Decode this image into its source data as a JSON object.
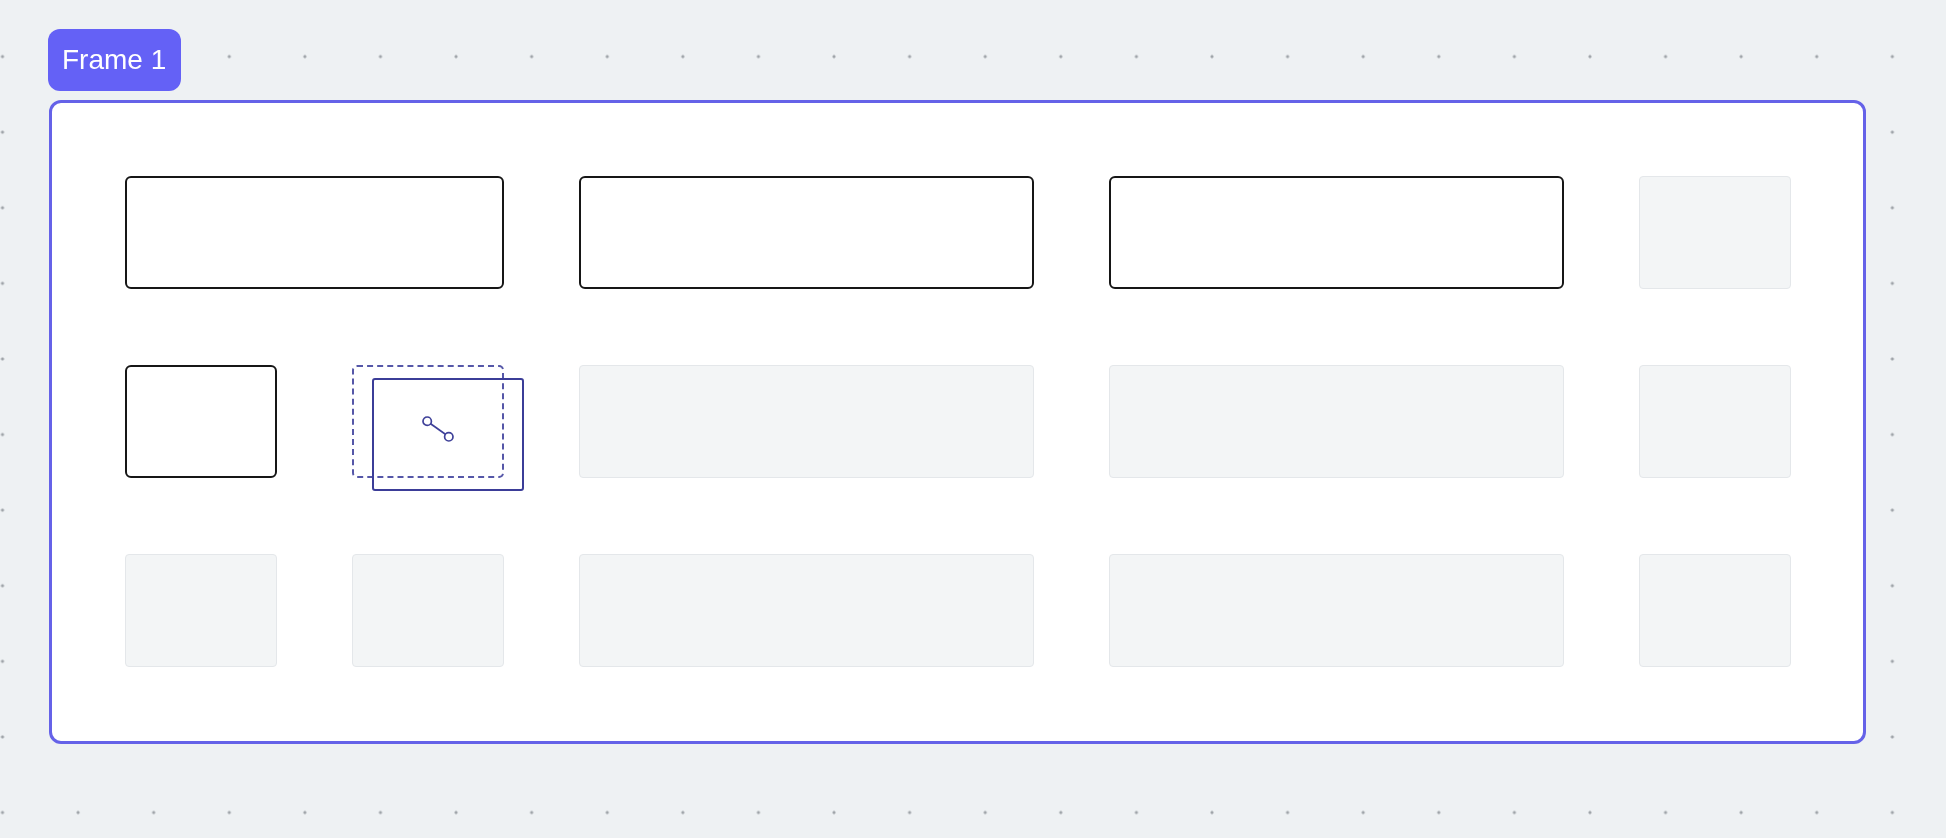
{
  "frame": {
    "label": "Frame 1",
    "selected": true
  },
  "grid": {
    "rows": [
      [
        {
          "kind": "block",
          "wide": true
        },
        {
          "kind": "block",
          "wide": false
        },
        {
          "kind": "block",
          "wide": false
        },
        {
          "kind": "slot",
          "wide": false
        }
      ],
      [
        {
          "kind": "block",
          "wide": false
        },
        {
          "kind": "target",
          "wide": false,
          "dragging": true
        },
        {
          "kind": "slot",
          "wide": false
        },
        {
          "kind": "slot",
          "wide": false
        },
        {
          "kind": "slot",
          "wide": false
        }
      ],
      [
        {
          "kind": "slot",
          "wide": false
        },
        {
          "kind": "slot",
          "wide": false
        },
        {
          "kind": "slot",
          "wide": false
        },
        {
          "kind": "slot",
          "wide": false
        },
        {
          "kind": "slot",
          "wide": false
        }
      ]
    ]
  }
}
